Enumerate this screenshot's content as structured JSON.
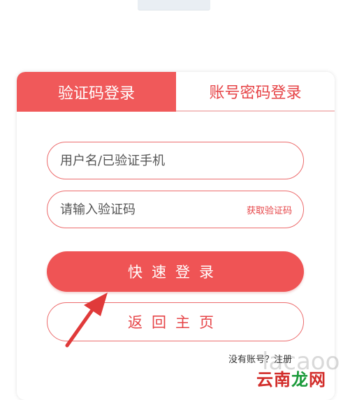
{
  "tabs": [
    {
      "label": "验证码登录",
      "active": true
    },
    {
      "label": "账号密码登录",
      "active": false
    }
  ],
  "form": {
    "username_placeholder": "用户名/已验证手机",
    "code_placeholder": "请输入验证码",
    "get_code_label": "获取验证码"
  },
  "buttons": {
    "quick_login": "快速登录",
    "back_home": "返回主页"
  },
  "register": {
    "question": "没有账号？",
    "link": "注册"
  },
  "watermark": {
    "text": "lacaoo",
    "brand_prefix": "云南",
    "brand_long": "龙",
    "brand_suffix": "网"
  },
  "colors": {
    "accent": "#f0595a",
    "accent_text": "#e64346",
    "border": "#ec6b6c",
    "arrow": "#e03a3a"
  }
}
